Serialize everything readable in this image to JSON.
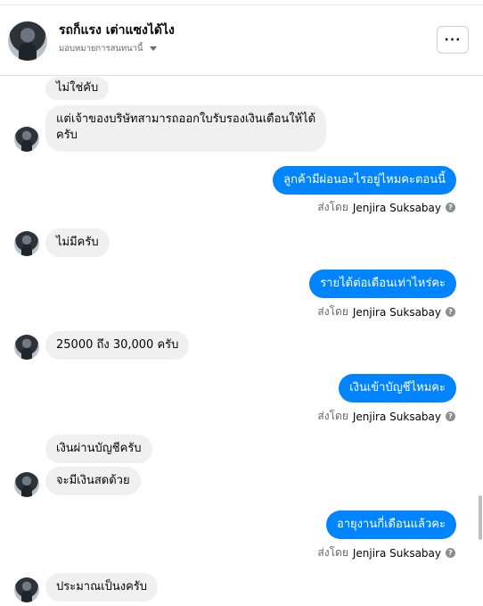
{
  "header": {
    "name": "รถก็แรง เต่าแซงได้ไง",
    "subtitle": "มอบหมายการสนทนานี้",
    "more_label": "···"
  },
  "messages": [
    {
      "text": "ไม่ใช่คับ"
    },
    {
      "line1": "แต่เจ้าของบริษัทสามารถออกใบรับรองเงินเดือนให้ได้",
      "line2": "ครับ"
    },
    {
      "text": "ลูกค้ามีผ่อนอะไรอยู่ไหมคะตอนนี้"
    },
    {
      "text": "ไม่มีครับ"
    },
    {
      "text": "รายได้ต่อเดือนเท่าไหร่คะ"
    },
    {
      "text": "25000 ถึง 30,000 ครับ"
    },
    {
      "text": "เงินเข้าบัญชีไหมคะ"
    },
    {
      "text": "เงินผ่านบัญชีครับ"
    },
    {
      "text": "จะมีเงินสดด้วย"
    },
    {
      "text": "อายุงานกี่เดือนแล้วคะ"
    },
    {
      "text": "ประมาณเป็นงครับ"
    }
  ],
  "sent_by": {
    "prefix": "ส่งโดย",
    "name": "Jenjira Suksabay",
    "info": "?"
  },
  "colors": {
    "outgoing": "#0084ff",
    "incoming": "#f0f0f0"
  }
}
